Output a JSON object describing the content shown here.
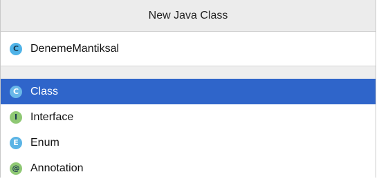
{
  "dialog": {
    "title": "New Java Class"
  },
  "name_field": {
    "value": "DenemeMantiksal",
    "icon": "class-icon",
    "icon_glyph": "C",
    "icon_color": "#4fb3e8"
  },
  "kinds": [
    {
      "label": "Class",
      "icon": "class-icon",
      "icon_glyph": "C",
      "icon_color": "#5bb4e5",
      "selected": true
    },
    {
      "label": "Interface",
      "icon": "interface-icon",
      "icon_glyph": "I",
      "icon_color": "#8fc874",
      "selected": false
    },
    {
      "label": "Enum",
      "icon": "enum-icon",
      "icon_glyph": "E",
      "icon_color": "#5bb4e5",
      "selected": false
    },
    {
      "label": "Annotation",
      "icon": "annotation-icon",
      "icon_glyph": "@",
      "icon_color": "#8fc874",
      "selected": false
    }
  ],
  "colors": {
    "selection": "#2f65ca",
    "title_bar": "#ececec"
  }
}
